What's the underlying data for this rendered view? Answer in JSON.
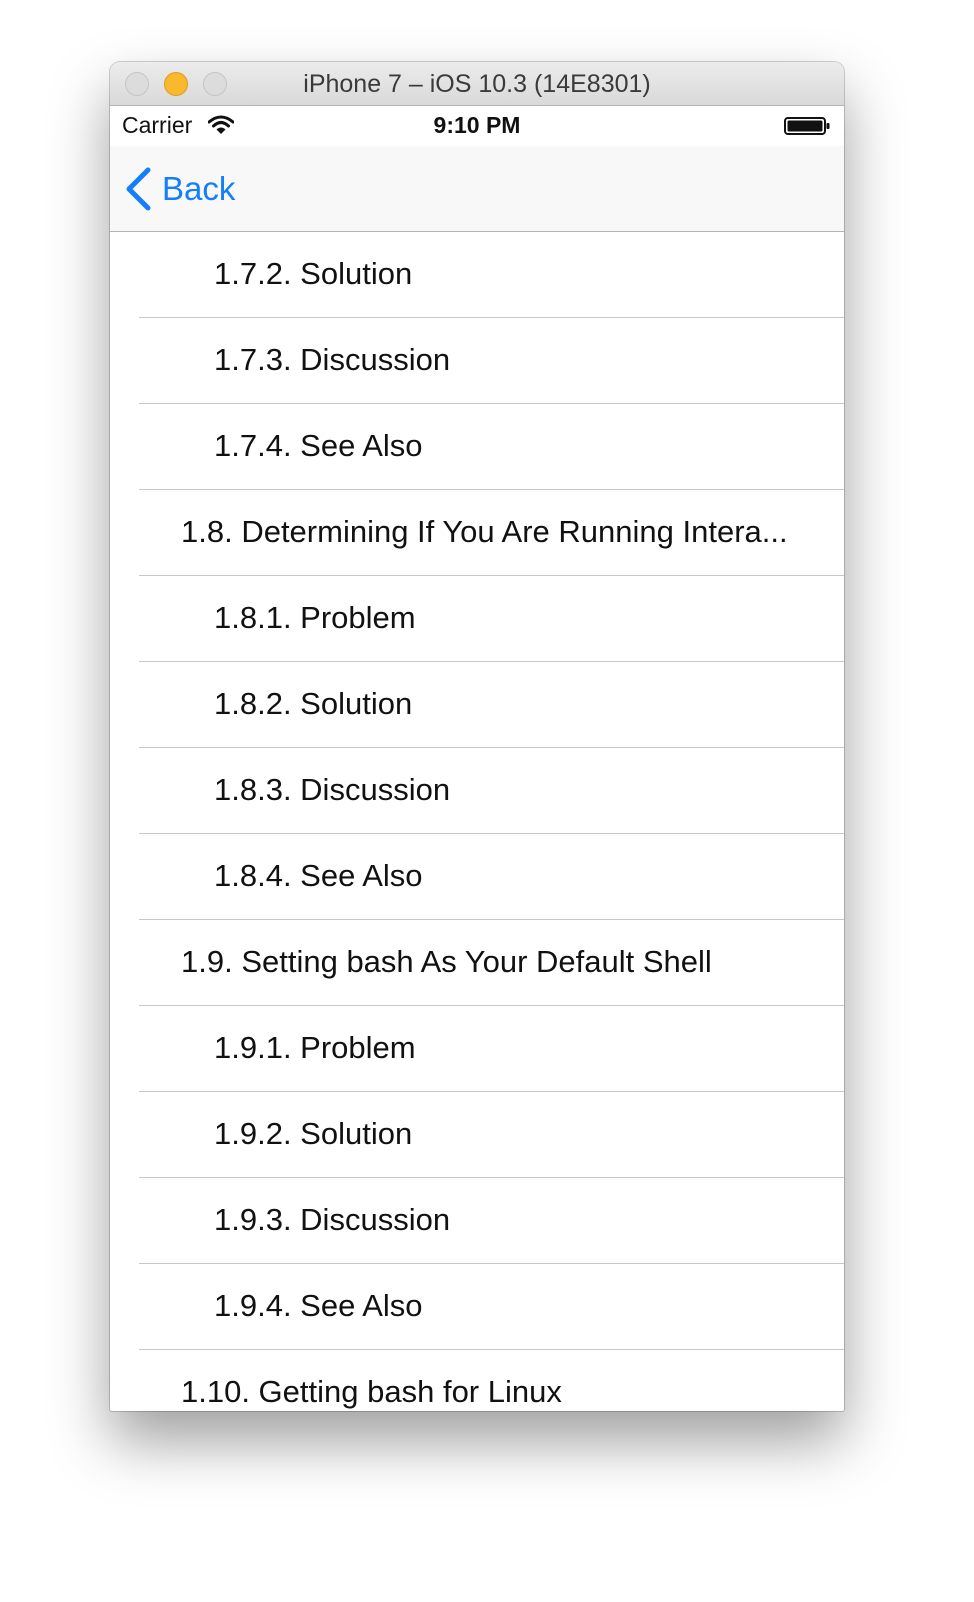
{
  "window": {
    "title": "iPhone 7 – iOS 10.3 (14E8301)"
  },
  "status_bar": {
    "carrier": "Carrier",
    "time": "9:10 PM",
    "wifi_icon": "wifi-icon",
    "battery_icon": "battery-icon"
  },
  "nav_bar": {
    "back_label": "Back",
    "back_icon": "chevron-left-icon",
    "accent_color": "#147efb"
  },
  "toc": {
    "items": [
      {
        "label": "1.7.2. Solution",
        "level": 2
      },
      {
        "label": "1.7.3. Discussion",
        "level": 2
      },
      {
        "label": "1.7.4. See Also",
        "level": 2
      },
      {
        "label": "1.8. Determining If You Are Running Intera...",
        "level": 1
      },
      {
        "label": "1.8.1. Problem",
        "level": 2
      },
      {
        "label": "1.8.2. Solution",
        "level": 2
      },
      {
        "label": "1.8.3. Discussion",
        "level": 2
      },
      {
        "label": "1.8.4. See Also",
        "level": 2
      },
      {
        "label": "1.9. Setting bash As Your Default Shell",
        "level": 1
      },
      {
        "label": "1.9.1. Problem",
        "level": 2
      },
      {
        "label": "1.9.2. Solution",
        "level": 2
      },
      {
        "label": "1.9.3. Discussion",
        "level": 2
      },
      {
        "label": "1.9.4. See Also",
        "level": 2
      },
      {
        "label": "1.10. Getting bash for Linux",
        "level": 1
      }
    ]
  }
}
